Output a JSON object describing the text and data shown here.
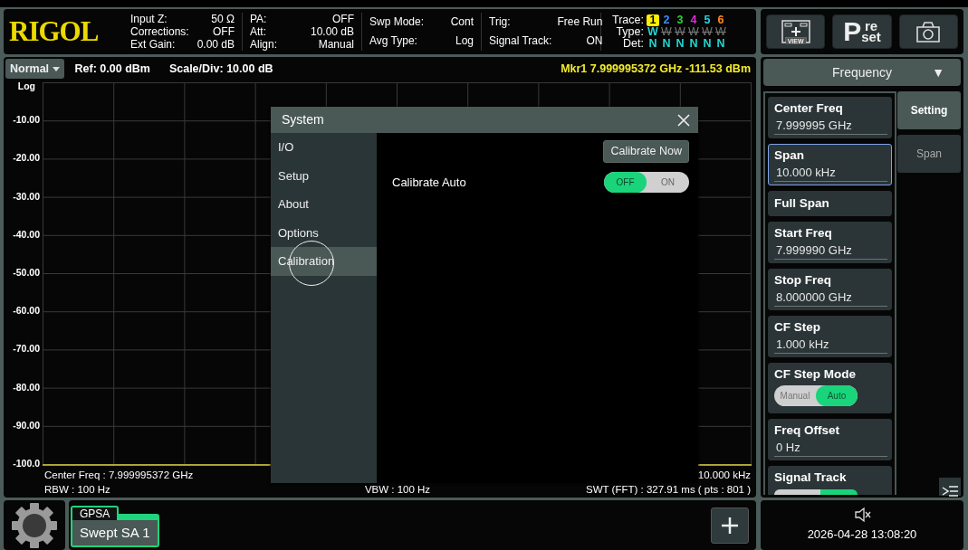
{
  "header": {
    "logo": "RIGOL",
    "columns": [
      {
        "rows": [
          {
            "label": "Input Z:",
            "value": "50 Ω"
          },
          {
            "label": "Corrections:",
            "value": "OFF"
          },
          {
            "label": "Ext Gain:",
            "value": "0.00 dB"
          }
        ]
      },
      {
        "rows": [
          {
            "label": "PA:",
            "value": "OFF"
          },
          {
            "label": "Att:",
            "value": "10.00 dB"
          },
          {
            "label": "Align:",
            "value": "Manual"
          }
        ]
      },
      {
        "rows": [
          {
            "label": "Swp Mode:",
            "value": "Cont"
          },
          {
            "label": "Avg Type:",
            "value": "Log"
          }
        ]
      },
      {
        "rows": [
          {
            "label": "Trig:",
            "value": "Free Run"
          },
          {
            "label": "Signal Track:",
            "value": "ON"
          }
        ]
      }
    ],
    "trace_labels": {
      "trace": "Trace:",
      "type": "Type:",
      "det": "Det:"
    },
    "traces": [
      {
        "number": "1",
        "color": "#fff200",
        "selected": true,
        "type": "W",
        "type_on": true,
        "det": "N"
      },
      {
        "number": "2",
        "color": "#3d8bff",
        "selected": false,
        "type": "W",
        "type_on": false,
        "det": "N"
      },
      {
        "number": "3",
        "color": "#2ed135",
        "selected": false,
        "type": "W",
        "type_on": false,
        "det": "N"
      },
      {
        "number": "4",
        "color": "#e02ae0",
        "selected": false,
        "type": "W",
        "type_on": false,
        "det": "N"
      },
      {
        "number": "5",
        "color": "#22d6e6",
        "selected": false,
        "type": "W",
        "type_on": false,
        "det": "N"
      },
      {
        "number": "6",
        "color": "#ff8a1c",
        "selected": false,
        "type": "W",
        "type_on": false,
        "det": "N"
      }
    ]
  },
  "toolbar": {
    "preset": {
      "initial": "P",
      "upper": "re",
      "lower": "set"
    },
    "view_label": "VIEW"
  },
  "graph": {
    "mode": "Normal",
    "ref": "Ref: 0.00 dBm",
    "scale": "Scale/Div: 10.00 dB",
    "marker": "Mkr1 7.999995372 GHz -111.53 dBm",
    "y_labels": [
      "Log",
      "-10.00",
      "-20.00",
      "-30.00",
      "-40.00",
      "-50.00",
      "-60.00",
      "-70.00",
      "-80.00",
      "-90.00",
      "-100.0"
    ],
    "center_freq": "Center Freq : 7.999995372 GHz",
    "span": "10.000 kHz",
    "rbw": "RBW : 100 Hz",
    "vbw": "VBW : 100 Hz",
    "swt": "SWT (FFT) : 327.91 ms ( pts : 801 )"
  },
  "dialog": {
    "title": "System",
    "nav": [
      {
        "label": "I/O",
        "selected": false
      },
      {
        "label": "Setup",
        "selected": false
      },
      {
        "label": "About",
        "selected": false
      },
      {
        "label": "Options",
        "selected": false
      },
      {
        "label": "Calibration",
        "selected": true
      }
    ],
    "actions": [
      {
        "label": "Calibrate Now"
      }
    ],
    "settings": [
      {
        "label": "Calibrate Auto",
        "kind": "toggle",
        "options": [
          {
            "label": "OFF",
            "selected": true
          },
          {
            "label": "ON",
            "selected": false
          }
        ]
      }
    ]
  },
  "menu": {
    "title": "Frequency",
    "arrow": "▼",
    "items": [
      {
        "kind": "value",
        "label": "Center Freq",
        "value": "7.999995 GHz",
        "selected": false
      },
      {
        "kind": "value",
        "label": "Span",
        "value": "10.000 kHz",
        "selected": true
      },
      {
        "kind": "button",
        "label": "Full Span",
        "selected": false
      },
      {
        "kind": "value",
        "label": "Start Freq",
        "value": "7.999990 GHz",
        "selected": false
      },
      {
        "kind": "value",
        "label": "Stop Freq",
        "value": "8.000000 GHz",
        "selected": false
      },
      {
        "kind": "value",
        "label": "CF Step",
        "value": "1.000 kHz",
        "selected": false
      },
      {
        "kind": "toggle",
        "label": "CF Step Mode",
        "selected": false,
        "options": [
          {
            "label": "Manual",
            "selected": false
          },
          {
            "label": "Auto",
            "selected": true
          }
        ]
      },
      {
        "kind": "value",
        "label": "Freq Offset",
        "value": "0 Hz",
        "selected": false
      },
      {
        "kind": "toggle_cut",
        "label": "Signal Track",
        "selected": false
      }
    ],
    "tabs": [
      {
        "label": "Setting",
        "selected": true
      },
      {
        "label": "Span",
        "selected": false
      }
    ]
  },
  "bottom": {
    "mode_tab": {
      "group": "GPSA",
      "name": "Swept SA 1"
    },
    "datetime": "2026-04-28 13:08:20"
  }
}
